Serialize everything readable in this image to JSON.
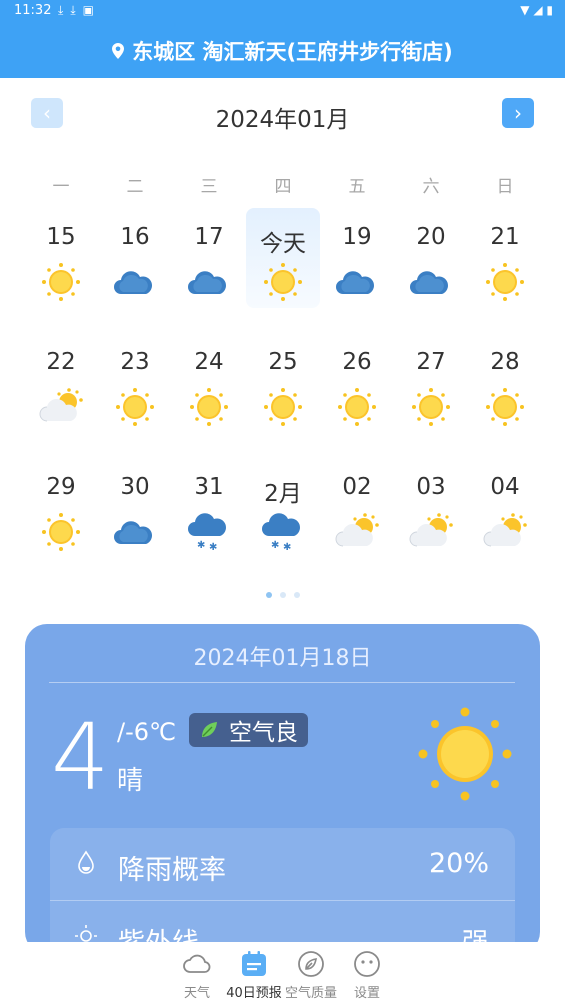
{
  "status_bar": {
    "time": "11:32",
    "icons": [
      "download-icon",
      "download-icon",
      "a-icon"
    ]
  },
  "header": {
    "location": "东城区 淘汇新天(王府井步行街店)"
  },
  "calendar": {
    "month_title": "2024年01月",
    "weekdays": [
      "一",
      "二",
      "三",
      "四",
      "五",
      "六",
      "日"
    ],
    "weeks": [
      [
        {
          "label": "15",
          "weather": "sunny"
        },
        {
          "label": "16",
          "weather": "cloudy"
        },
        {
          "label": "17",
          "weather": "cloudy"
        },
        {
          "label": "今天",
          "weather": "sunny"
        },
        {
          "label": "19",
          "weather": "cloudy"
        },
        {
          "label": "20",
          "weather": "cloudy"
        },
        {
          "label": "21",
          "weather": "sunny"
        }
      ],
      [
        {
          "label": "22",
          "weather": "partly-cloudy"
        },
        {
          "label": "23",
          "weather": "sunny"
        },
        {
          "label": "24",
          "weather": "sunny"
        },
        {
          "label": "25",
          "weather": "sunny"
        },
        {
          "label": "26",
          "weather": "sunny"
        },
        {
          "label": "27",
          "weather": "sunny"
        },
        {
          "label": "28",
          "weather": "sunny"
        }
      ],
      [
        {
          "label": "29",
          "weather": "sunny"
        },
        {
          "label": "30",
          "weather": "cloudy"
        },
        {
          "label": "31",
          "weather": "snow"
        },
        {
          "label": "2月",
          "weather": "snow"
        },
        {
          "label": "02",
          "weather": "partly-cloudy"
        },
        {
          "label": "03",
          "weather": "partly-cloudy"
        },
        {
          "label": "04",
          "weather": "partly-cloudy"
        }
      ]
    ],
    "page_dots": 3,
    "active_dot": 0
  },
  "detail_card": {
    "date": "2024年01月18日",
    "temp_high": "4",
    "temp_low": "/-6℃",
    "air_quality": "空气良",
    "condition": "晴",
    "items": [
      {
        "label": "降雨概率",
        "value": "20%",
        "icon": "raindrop-icon"
      },
      {
        "label": "紫外线",
        "value": "强",
        "icon": "sun-uv-icon"
      }
    ]
  },
  "tabs": [
    {
      "label": "天气",
      "icon": "cloud-icon"
    },
    {
      "label": "40日预报",
      "icon": "calendar-icon"
    },
    {
      "label": "空气质量",
      "icon": "leaf-icon"
    },
    {
      "label": "设置",
      "icon": "face-icon"
    }
  ],
  "colors": {
    "header_blue": "#3ea2f5",
    "card_blue": "#79a7e9",
    "aq_badge": "#45608f"
  }
}
